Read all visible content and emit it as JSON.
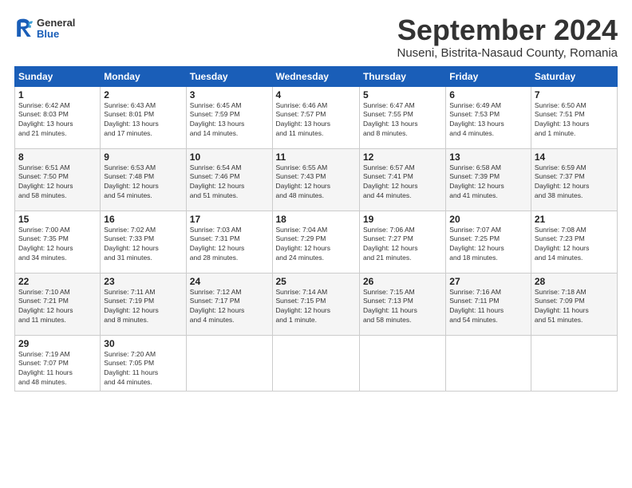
{
  "header": {
    "logo": {
      "general": "General",
      "blue": "Blue"
    },
    "title": "September 2024",
    "subtitle": "Nuseni, Bistrita-Nasaud County, Romania"
  },
  "calendar": {
    "days_of_week": [
      "Sunday",
      "Monday",
      "Tuesday",
      "Wednesday",
      "Thursday",
      "Friday",
      "Saturday"
    ],
    "weeks": [
      [
        {
          "day": "",
          "empty": true
        },
        {
          "day": "",
          "empty": true
        },
        {
          "day": "",
          "empty": true
        },
        {
          "day": "",
          "empty": true
        },
        {
          "day": "",
          "empty": true
        },
        {
          "day": "",
          "empty": true
        },
        {
          "day": "",
          "empty": true
        }
      ],
      [
        {
          "day": "1",
          "info": "Sunrise: 6:42 AM\nSunset: 8:03 PM\nDaylight: 13 hours\nand 21 minutes."
        },
        {
          "day": "2",
          "info": "Sunrise: 6:43 AM\nSunset: 8:01 PM\nDaylight: 13 hours\nand 17 minutes."
        },
        {
          "day": "3",
          "info": "Sunrise: 6:45 AM\nSunset: 7:59 PM\nDaylight: 13 hours\nand 14 minutes."
        },
        {
          "day": "4",
          "info": "Sunrise: 6:46 AM\nSunset: 7:57 PM\nDaylight: 13 hours\nand 11 minutes."
        },
        {
          "day": "5",
          "info": "Sunrise: 6:47 AM\nSunset: 7:55 PM\nDaylight: 13 hours\nand 8 minutes."
        },
        {
          "day": "6",
          "info": "Sunrise: 6:49 AM\nSunset: 7:53 PM\nDaylight: 13 hours\nand 4 minutes."
        },
        {
          "day": "7",
          "info": "Sunrise: 6:50 AM\nSunset: 7:51 PM\nDaylight: 13 hours\nand 1 minute."
        }
      ],
      [
        {
          "day": "8",
          "info": "Sunrise: 6:51 AM\nSunset: 7:50 PM\nDaylight: 12 hours\nand 58 minutes."
        },
        {
          "day": "9",
          "info": "Sunrise: 6:53 AM\nSunset: 7:48 PM\nDaylight: 12 hours\nand 54 minutes."
        },
        {
          "day": "10",
          "info": "Sunrise: 6:54 AM\nSunset: 7:46 PM\nDaylight: 12 hours\nand 51 minutes."
        },
        {
          "day": "11",
          "info": "Sunrise: 6:55 AM\nSunset: 7:43 PM\nDaylight: 12 hours\nand 48 minutes."
        },
        {
          "day": "12",
          "info": "Sunrise: 6:57 AM\nSunset: 7:41 PM\nDaylight: 12 hours\nand 44 minutes."
        },
        {
          "day": "13",
          "info": "Sunrise: 6:58 AM\nSunset: 7:39 PM\nDaylight: 12 hours\nand 41 minutes."
        },
        {
          "day": "14",
          "info": "Sunrise: 6:59 AM\nSunset: 7:37 PM\nDaylight: 12 hours\nand 38 minutes."
        }
      ],
      [
        {
          "day": "15",
          "info": "Sunrise: 7:00 AM\nSunset: 7:35 PM\nDaylight: 12 hours\nand 34 minutes."
        },
        {
          "day": "16",
          "info": "Sunrise: 7:02 AM\nSunset: 7:33 PM\nDaylight: 12 hours\nand 31 minutes."
        },
        {
          "day": "17",
          "info": "Sunrise: 7:03 AM\nSunset: 7:31 PM\nDaylight: 12 hours\nand 28 minutes."
        },
        {
          "day": "18",
          "info": "Sunrise: 7:04 AM\nSunset: 7:29 PM\nDaylight: 12 hours\nand 24 minutes."
        },
        {
          "day": "19",
          "info": "Sunrise: 7:06 AM\nSunset: 7:27 PM\nDaylight: 12 hours\nand 21 minutes."
        },
        {
          "day": "20",
          "info": "Sunrise: 7:07 AM\nSunset: 7:25 PM\nDaylight: 12 hours\nand 18 minutes."
        },
        {
          "day": "21",
          "info": "Sunrise: 7:08 AM\nSunset: 7:23 PM\nDaylight: 12 hours\nand 14 minutes."
        }
      ],
      [
        {
          "day": "22",
          "info": "Sunrise: 7:10 AM\nSunset: 7:21 PM\nDaylight: 12 hours\nand 11 minutes."
        },
        {
          "day": "23",
          "info": "Sunrise: 7:11 AM\nSunset: 7:19 PM\nDaylight: 12 hours\nand 8 minutes."
        },
        {
          "day": "24",
          "info": "Sunrise: 7:12 AM\nSunset: 7:17 PM\nDaylight: 12 hours\nand 4 minutes."
        },
        {
          "day": "25",
          "info": "Sunrise: 7:14 AM\nSunset: 7:15 PM\nDaylight: 12 hours\nand 1 minute."
        },
        {
          "day": "26",
          "info": "Sunrise: 7:15 AM\nSunset: 7:13 PM\nDaylight: 11 hours\nand 58 minutes."
        },
        {
          "day": "27",
          "info": "Sunrise: 7:16 AM\nSunset: 7:11 PM\nDaylight: 11 hours\nand 54 minutes."
        },
        {
          "day": "28",
          "info": "Sunrise: 7:18 AM\nSunset: 7:09 PM\nDaylight: 11 hours\nand 51 minutes."
        }
      ],
      [
        {
          "day": "29",
          "info": "Sunrise: 7:19 AM\nSunset: 7:07 PM\nDaylight: 11 hours\nand 48 minutes."
        },
        {
          "day": "30",
          "info": "Sunrise: 7:20 AM\nSunset: 7:05 PM\nDaylight: 11 hours\nand 44 minutes."
        },
        {
          "day": "",
          "empty": true
        },
        {
          "day": "",
          "empty": true
        },
        {
          "day": "",
          "empty": true
        },
        {
          "day": "",
          "empty": true
        },
        {
          "day": "",
          "empty": true
        }
      ]
    ]
  }
}
